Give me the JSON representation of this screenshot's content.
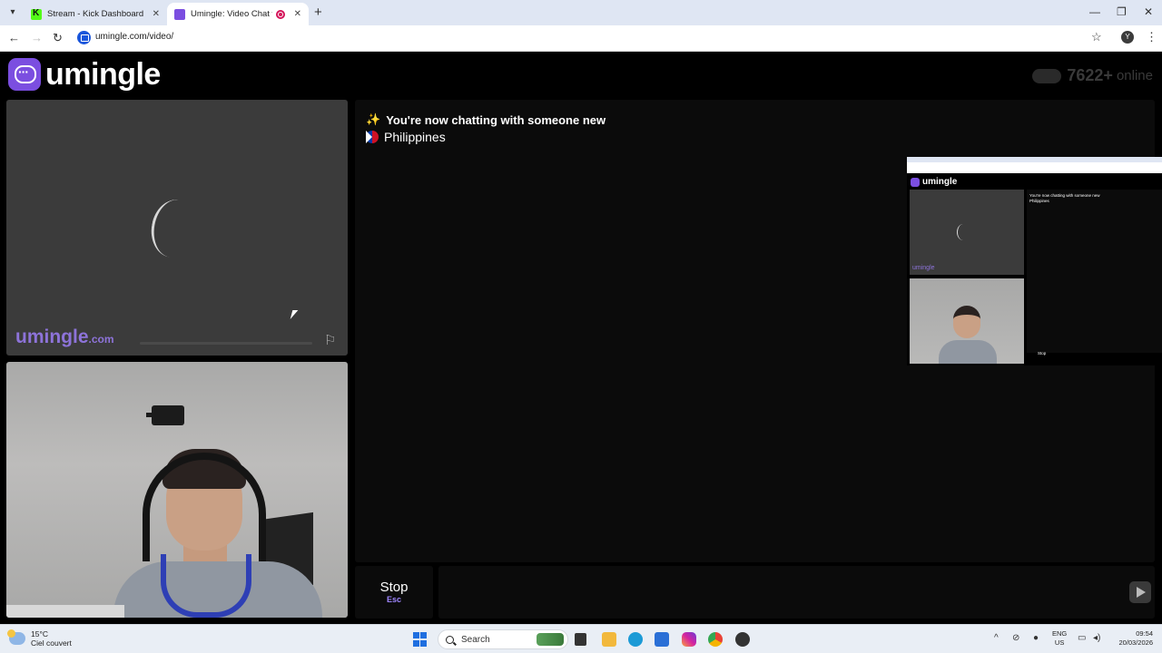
{
  "browser": {
    "tabs": [
      {
        "title": "Stream - Kick Dashboard",
        "favicon": "kick-icon"
      },
      {
        "title": "Umingle: Video Chat with S",
        "favicon": "umingle-icon"
      }
    ],
    "url": "umingle.com/video/",
    "profile_initial": "Y"
  },
  "header": {
    "logo_text": "umingle",
    "online_count": "7622+",
    "online_label": "online"
  },
  "stranger_panel": {
    "watermark": "umingle",
    "watermark_suffix": ".com",
    "loading_progress": 0.0
  },
  "chat": {
    "status_icon": "sparkles-icon",
    "status_text": "You're now chatting with someone new",
    "country": "Philippines",
    "message_placeholder": ""
  },
  "preview": {
    "logo_text": "umingle",
    "status_text": "You're now chatting with someone new",
    "country": "Philippines",
    "watermark": "umingle",
    "stop_label": "Stop"
  },
  "controls": {
    "stop_label": "Stop",
    "stop_hint": "Esc"
  },
  "taskbar": {
    "temperature": "15°C",
    "weather": "Ciel couvert",
    "search_label": "Search",
    "language": "ENG",
    "region": "US",
    "time": "09:54",
    "date": "20/03/2026"
  },
  "colors": {
    "brand": "#7b4ee0",
    "watermark": "#8d73d9",
    "stop_hint": "#9f86ff"
  }
}
